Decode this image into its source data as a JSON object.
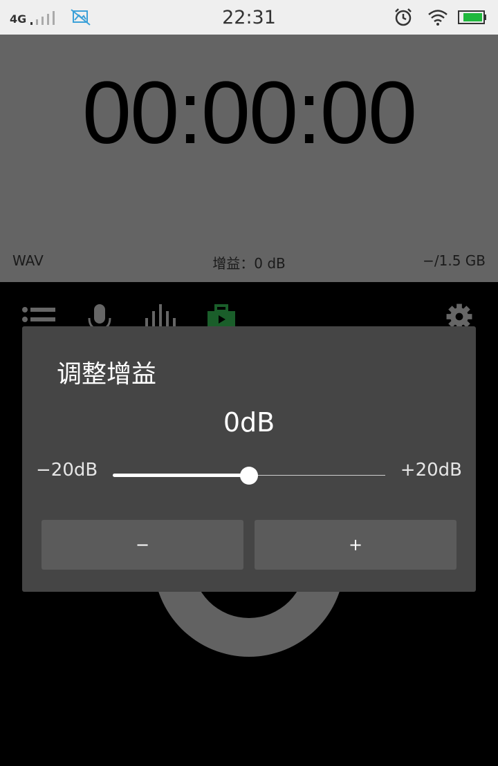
{
  "status_bar": {
    "network": "4G",
    "time": "22:31",
    "icons": [
      "signal-icon",
      "photo-icon",
      "alarm-icon",
      "wifi-icon",
      "battery-icon"
    ],
    "battery_color": "#1fb83d"
  },
  "recorder": {
    "timer": "00:00:00",
    "format": "WAV",
    "gain": "增益：0 dB",
    "storage": "−/1.5 GB"
  },
  "toolbar": {
    "icons": [
      "list-icon",
      "microphone-icon",
      "equalizer-icon",
      "briefcase-play-icon",
      "gear-icon"
    ],
    "active_color": "#1a5e2a"
  },
  "dialog": {
    "title": "调整增益",
    "value": "0dB",
    "min_label": "−20dB",
    "max_label": "+20dB",
    "slider_fraction": 0.5,
    "minus_label": "−",
    "plus_label": "+"
  }
}
